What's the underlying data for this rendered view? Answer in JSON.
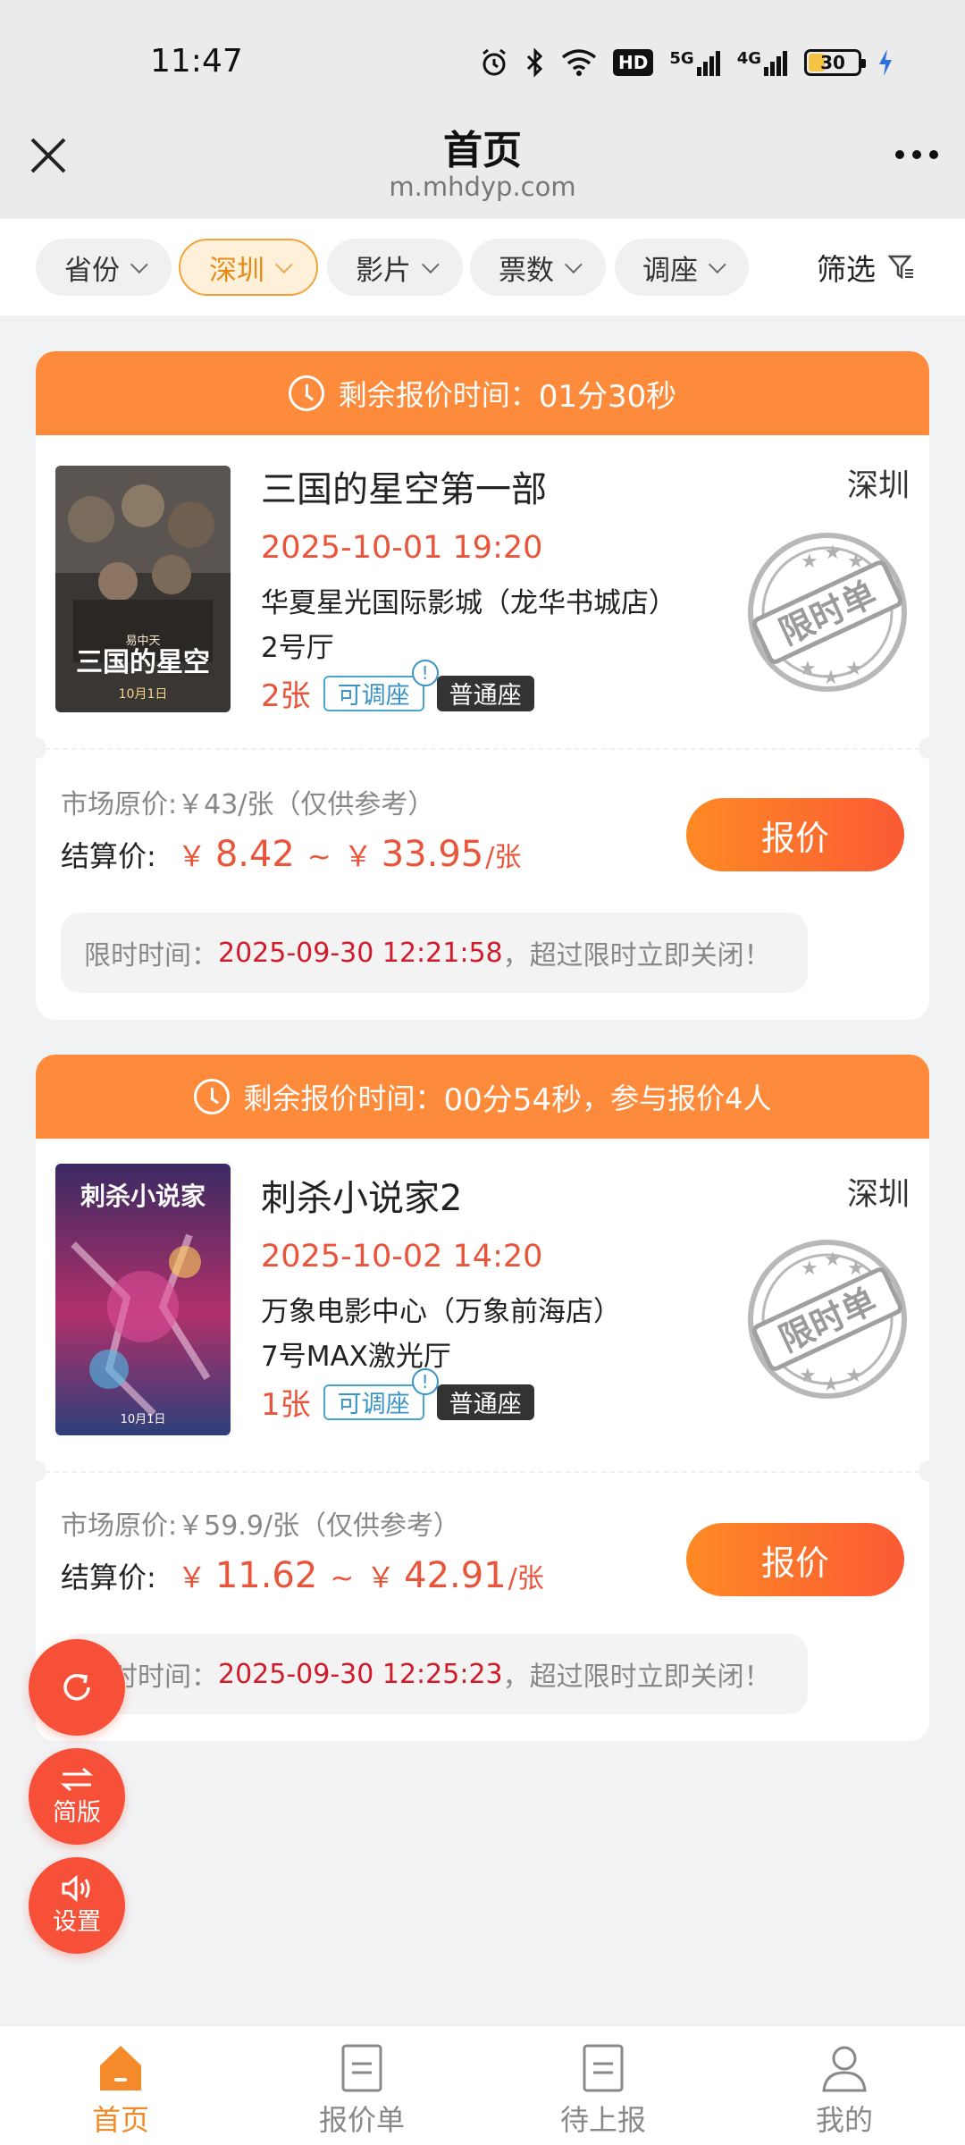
{
  "status_bar": {
    "time": "11:47",
    "battery": "30",
    "net1": "5G",
    "net2": "4G",
    "hd": "HD"
  },
  "header": {
    "title": "首页",
    "domain": "m.mhdyp.com"
  },
  "filters": {
    "items": [
      "省份",
      "深圳",
      "影片",
      "票数",
      "调座"
    ],
    "active": "深圳",
    "filter_label": "筛选"
  },
  "orders": [
    {
      "countdown": "剩余报价时间：",
      "countdown_value": "01分30秒",
      "participants": "",
      "title": "三国的星空第一部",
      "city": "深圳",
      "showtime": "2025-10-01 19:20",
      "cinema": "华夏星光国际影城（龙华书城店）",
      "hall": "2号厅",
      "count": "2张",
      "adjust_tag": "可调座",
      "seat_tag": "普通座",
      "stamp_text": "限时单",
      "market_price": "市场原价:￥43/张（仅供参考）",
      "settle_label": "结算价:",
      "price_low": "8.42",
      "price_high": "33.95",
      "yen": "￥",
      "tilde": "~",
      "unit": "/张",
      "quote_label": "报价",
      "deadline_label": "限时时间：",
      "deadline_time": "2025-09-30 12:21:58",
      "deadline_suffix": "，超过限时立即关闭！"
    },
    {
      "countdown": "剩余报价时间：",
      "countdown_value": "00分54秒",
      "participants": "，参与报价4人",
      "title": "刺杀小说家2",
      "city": "深圳",
      "showtime": "2025-10-02 14:20",
      "cinema": "万象电影中心（万象前海店）",
      "hall": "7号MAX激光厅",
      "count": "1张",
      "adjust_tag": "可调座",
      "seat_tag": "普通座",
      "stamp_text": "限时单",
      "market_price": "市场原价:￥59.9/张（仅供参考）",
      "settle_label": "结算价:",
      "price_low": "11.62",
      "price_high": "42.91",
      "yen": "￥",
      "tilde": "~",
      "unit": "/张",
      "quote_label": "报价",
      "deadline_label": "限时时间：",
      "deadline_time": "2025-09-30 12:25:23",
      "deadline_suffix": "，超过限时立即关闭！"
    }
  ],
  "posters": [
    {
      "top_text": "易中天",
      "main_text": "三国的星空",
      "date_text": "10月1日"
    },
    {
      "main_text": "刺杀小说家",
      "date_text": "10月1日"
    }
  ],
  "fabs": {
    "refresh_icon": "refresh-icon",
    "simple_label": "简版",
    "settings_label": "设置"
  },
  "bottom_nav": [
    {
      "label": "首页",
      "icon": "home-icon"
    },
    {
      "label": "报价单",
      "icon": "document-icon"
    },
    {
      "label": "待上报",
      "icon": "document-icon"
    },
    {
      "label": "我的",
      "icon": "user-icon"
    }
  ],
  "colors": {
    "accent": "#fd8b3b",
    "price": "#e8553b",
    "deadline": "#d01b2a",
    "fab": "#f65038",
    "active_nav": "#f08a27"
  }
}
